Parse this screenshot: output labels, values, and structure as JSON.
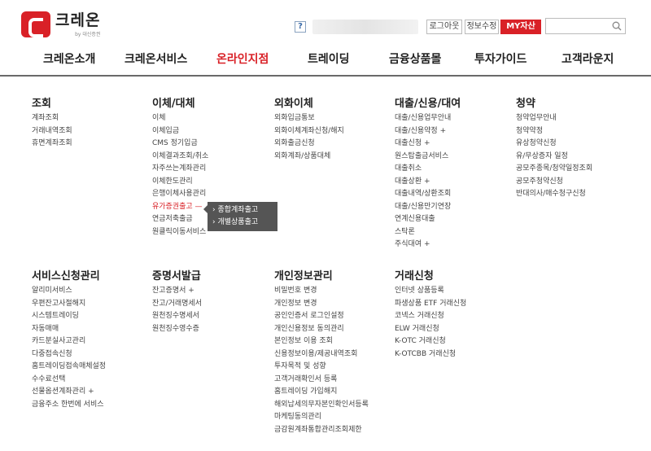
{
  "brand": {
    "name": "크레온",
    "sub": "by 대신증권"
  },
  "util": {
    "help": "?",
    "logout": "로그아웃",
    "info_edit": "정보수정",
    "my_asset": "MY자산",
    "search_placeholder": ""
  },
  "gnb": [
    "크레온소개",
    "크레온서비스",
    "온라인지점",
    "트레이딩",
    "금융상품몰",
    "투자가이드",
    "고객라운지"
  ],
  "menu": {
    "inquiry": {
      "title": "조회",
      "items": [
        "계좌조회",
        "거래내역조회",
        "휴면계좌조회"
      ]
    },
    "transfer": {
      "title": "이체/대체",
      "items": [
        "이체",
        "이체입금",
        "CMS 정기입금",
        "이체결과조회/취소",
        "자주쓰는계좌관리",
        "이체한도관리",
        "은행이체사용관리",
        "유가증권출고 —",
        "연금저축출금",
        "원클릭이동서비스"
      ]
    },
    "fx": {
      "title": "외화이체",
      "items": [
        "외화입금통보",
        "외화이체계좌신청/해지",
        "외화출금신청",
        "외화계좌/상품대체"
      ]
    },
    "loan": {
      "title": "대출/신용/대여",
      "items": [
        "대출/신용업무안내",
        "대출/신용약정 +",
        "대출신청 +",
        "원스탑출금서비스",
        "대출취소",
        "대출상환 +",
        "대출내역/상환조회",
        "대출/신용만기연장",
        "연계신용대출",
        "스탁론",
        "주식대여 +"
      ]
    },
    "subscription": {
      "title": "청약",
      "items": [
        "청약업무안내",
        "청약약정",
        "유상청약신청",
        "유/무상증자 일정",
        "공모주종목/청약일정조회",
        "공모주청약신청",
        "반대의사/매수청구신청"
      ]
    },
    "service": {
      "title": "서비스신청관리",
      "items": [
        "알리미서비스",
        "우편잔고사절해지",
        "시스템트레이딩",
        "자동매매",
        "카드분실사고관리",
        "다중접속신청",
        "홈트레이딩접속매체설정",
        "수수료선택",
        "선물옵션계좌관리 +",
        "금융주소 한번에 서비스"
      ]
    },
    "certificate": {
      "title": "증명서발급",
      "items": [
        "잔고증명서 +",
        "잔고/거래명세서",
        "원천징수명세서",
        "원천징수영수증"
      ]
    },
    "privacy": {
      "title": "개인정보관리",
      "items": [
        "비밀번호 변경",
        "개인정보 변경",
        "공인인증서 로그인설정",
        "개인신용정보 동의관리",
        "본인정보 이용 조회",
        "신용정보이용/제공내역조회",
        "투자목적 및 성향",
        "고객거래확인서 등록",
        "홈트레이딩 가입해지",
        "해외납세의무자본인확인서등록",
        "마케팅동의관리",
        "금감원계좌통합관리조회제한"
      ]
    },
    "trade_apply": {
      "title": "거래신청",
      "items": [
        "인터넷 상품등록",
        "파생상품 ETF 거래신청",
        "코넥스 거래신청",
        "ELW 거래신청",
        "K-OTC 거래신청",
        "K-OTCBB 거래신청"
      ]
    }
  },
  "submenu": [
    "› 종합계좌출고",
    "› 개별상품출고"
  ]
}
